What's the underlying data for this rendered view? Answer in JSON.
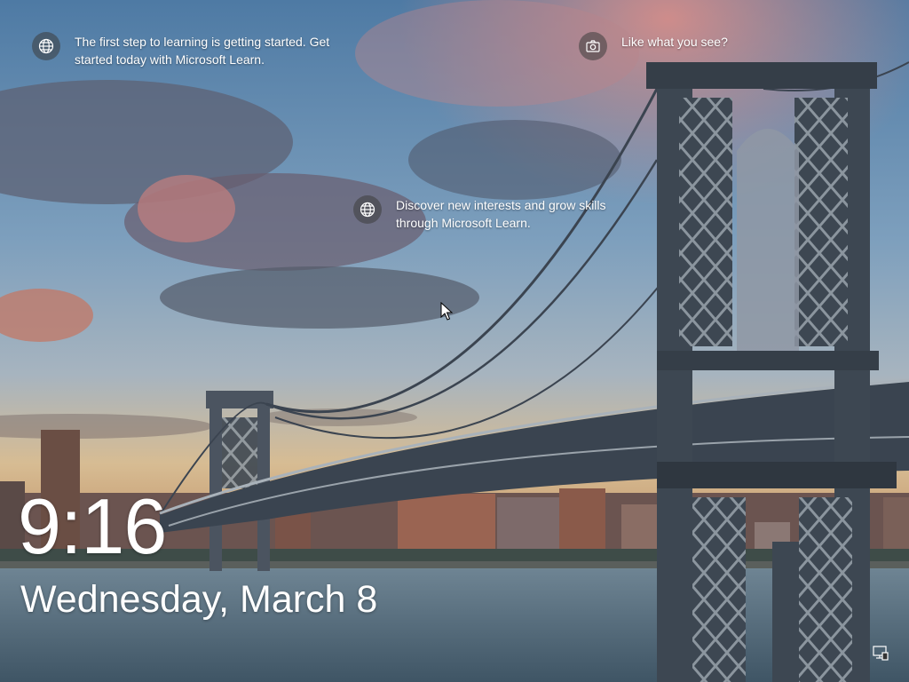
{
  "spotlight": {
    "items": [
      {
        "icon": "globe-icon",
        "text": "The first step to learning is getting started. Get started today with Microsoft Learn."
      },
      {
        "icon": "globe-icon",
        "text": "Discover new interests and grow skills through Microsoft Learn."
      },
      {
        "icon": "camera-icon",
        "text": "Like what you see?"
      }
    ]
  },
  "lockscreen": {
    "time": "9:16",
    "date": "Wednesday, March 8"
  },
  "tray": {
    "icon": "network-icon"
  },
  "colors": {
    "sky_top": "#5f86ad",
    "sky_glow": "#e0b680",
    "cloud": "#5a5f6e",
    "water": "#4e6878",
    "bridge": "#3d4752"
  }
}
